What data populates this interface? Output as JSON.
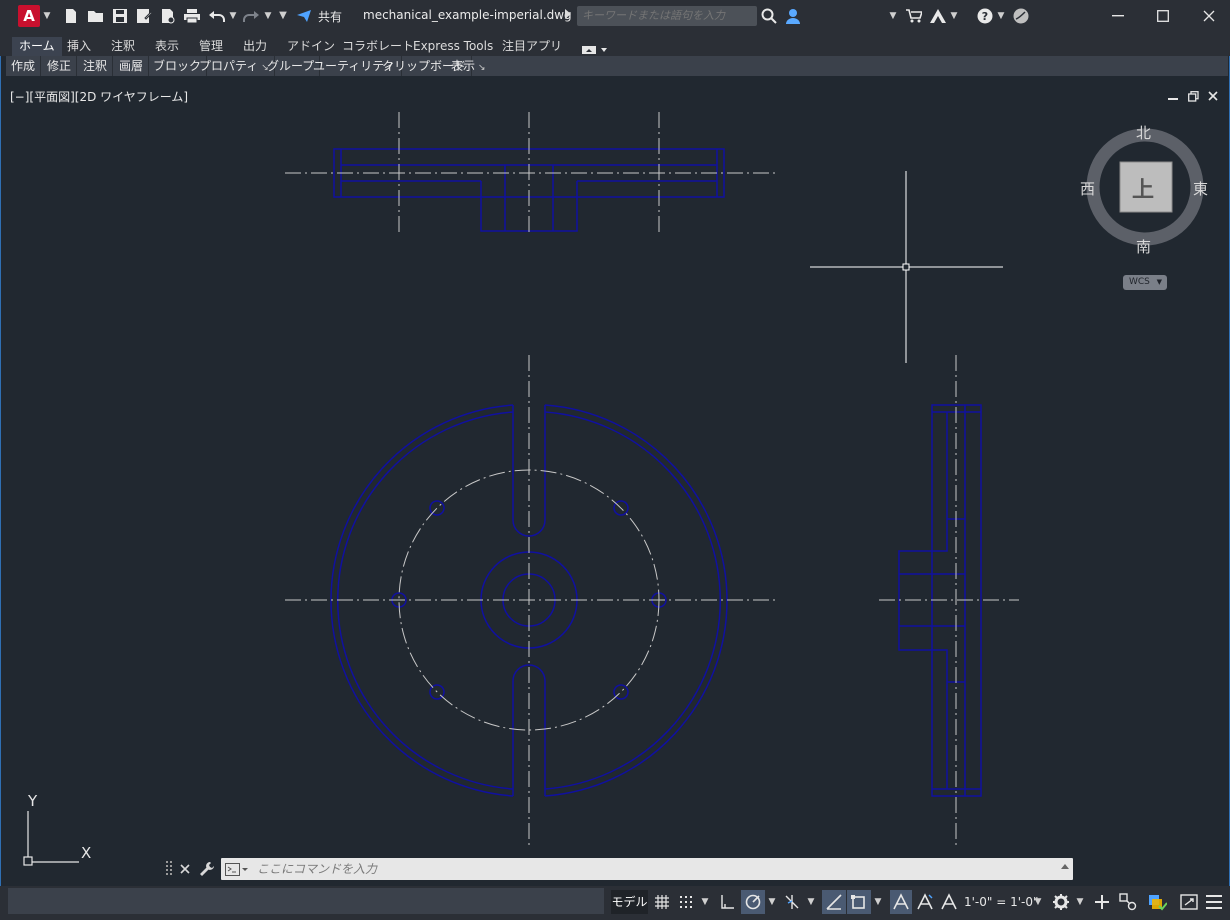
{
  "titlebar": {
    "app_logo": "A",
    "share_label": "共有",
    "filename": "mechanical_example-imperial.dwg",
    "search_placeholder": "キーワードまたは語句を入力",
    "icons": [
      "new-icon",
      "open-icon",
      "save-icon",
      "save-as-icon",
      "plot-preview-icon",
      "print-icon",
      "undo-icon",
      "redo-icon",
      "share-icon",
      "search-icon",
      "user-icon",
      "cart-icon",
      "autodesk-icon",
      "help-icon",
      "collaborate-icon"
    ]
  },
  "ribbon": {
    "tabs": [
      "ホーム",
      "挿入",
      "注釈",
      "表示",
      "管理",
      "出力",
      "アドイン",
      "コラボレート",
      "Express Tools",
      "注目アプリ"
    ],
    "active_tab": "ホーム",
    "panels": [
      "作成",
      "修正",
      "注釈",
      "画層",
      "ブロック",
      "プロパティ",
      "グループ",
      "ユーティリティ",
      "クリップボード",
      "表示"
    ]
  },
  "viewport": {
    "label": "[−][平面図][2D ワイヤフレーム]"
  },
  "viewcube": {
    "north": "北",
    "south": "南",
    "east": "東",
    "west": "西",
    "face": "上",
    "wcs": "WCS"
  },
  "ucs": {
    "x": "X",
    "y": "Y"
  },
  "command": {
    "placeholder": "ここにコマンドを入力"
  },
  "statusbar": {
    "model": "モデル",
    "scale": "1'-0\" = 1'-0\""
  },
  "colors": {
    "background": "#212830",
    "geometry": "#1010a0",
    "centerline": "#c8c8c8",
    "crosshair": "#ffffff",
    "accent": "#2f6fb3"
  }
}
